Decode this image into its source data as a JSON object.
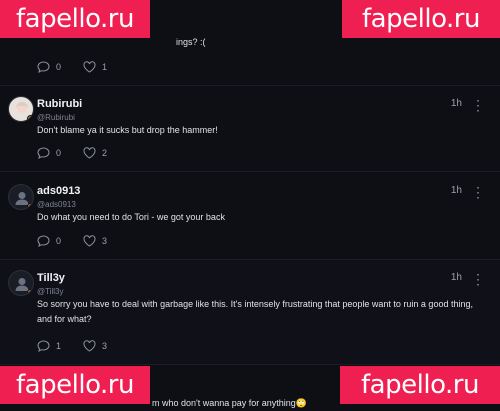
{
  "watermark": {
    "text": "fapello.ru",
    "color": "#ef1f52"
  },
  "comments": [
    {
      "name": "",
      "handle": "",
      "time": "",
      "text": "ings? :(",
      "replies": "0",
      "likes": "1"
    },
    {
      "name": "Rubirubi",
      "handle": "@Rubirubi",
      "time": "1h",
      "text": "Don't blame ya it sucks but drop the hammer!",
      "replies": "0",
      "likes": "2"
    },
    {
      "name": "ads0913",
      "handle": "@ads0913",
      "time": "1h",
      "text": "Do what you need to do Tori - we got your back",
      "replies": "0",
      "likes": "3"
    },
    {
      "name": "Till3y",
      "handle": "@Till3y",
      "time": "1h",
      "text": "So sorry you have to deal with garbage like this. It's intensely frustrating that people want to ruin a good thing, and for what?",
      "replies": "1",
      "likes": "3"
    },
    {
      "name": "",
      "handle": "",
      "time": "",
      "text": "m who don't wanna pay for anything🙄",
      "replies": "",
      "likes": ""
    }
  ],
  "more_icon": "more-dots-icon",
  "colors": {
    "background": "#0e0f14",
    "accent_dot": "#b7852e"
  }
}
